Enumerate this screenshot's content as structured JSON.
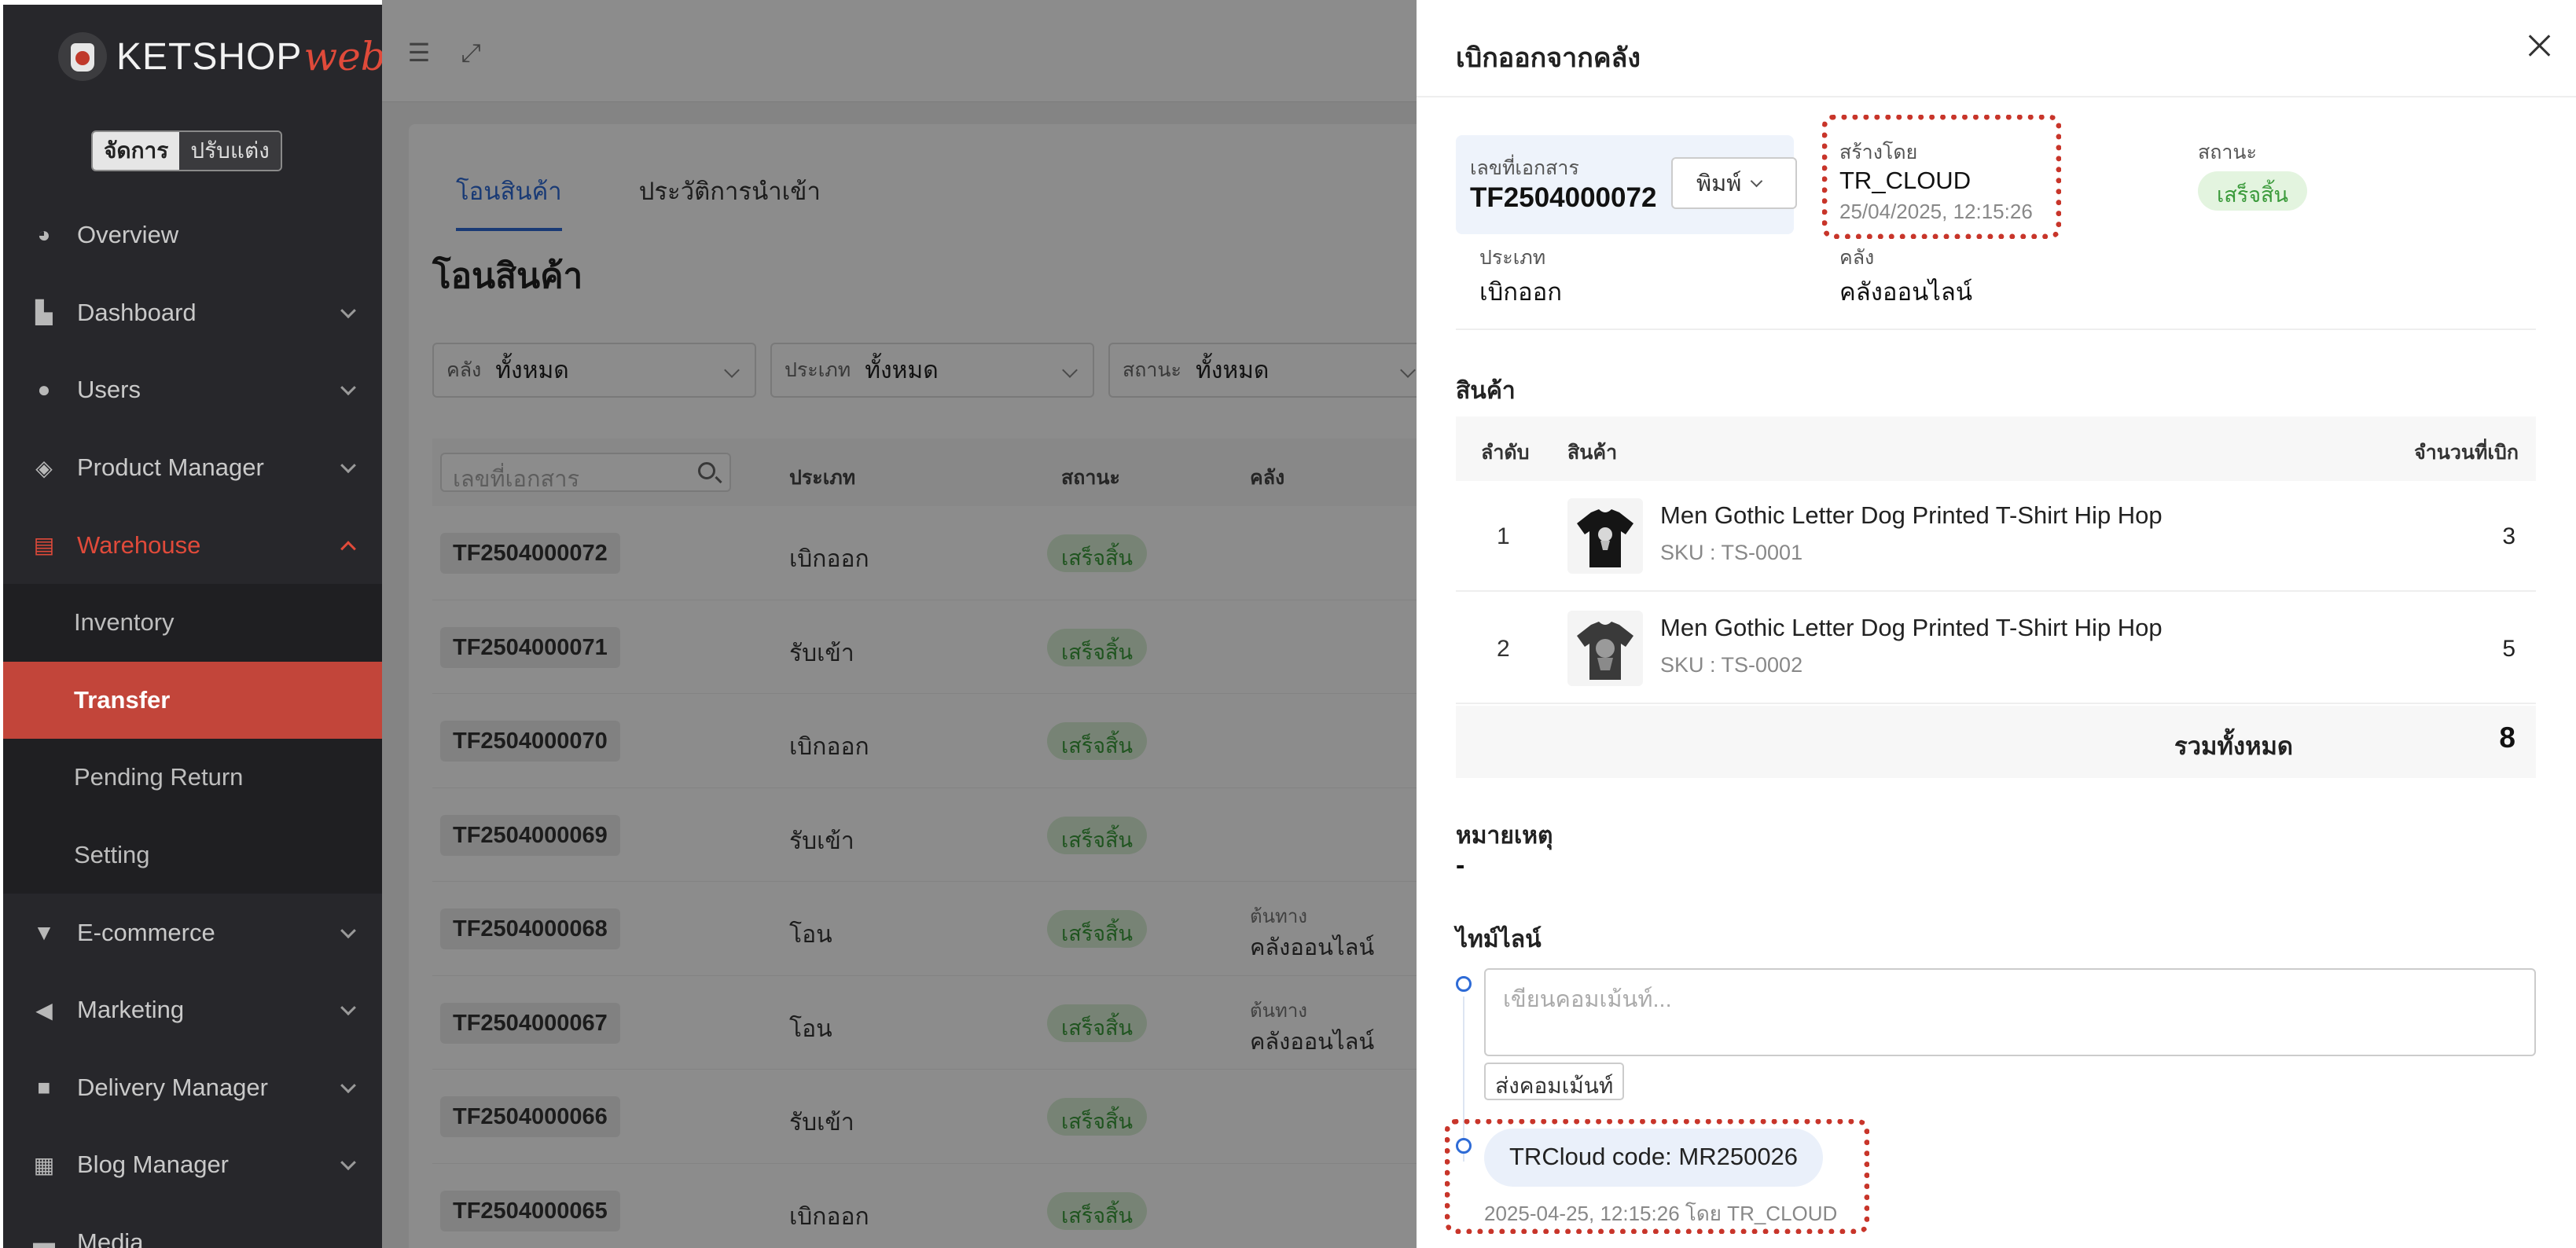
{
  "brand": {
    "name": "KETSHOP",
    "suffix": "web"
  },
  "mode": {
    "manage": "จัดการ",
    "customize": "ปรับแต่ง"
  },
  "nav": [
    {
      "label": "Overview",
      "icon": "pie-chart-icon"
    },
    {
      "label": "Dashboard",
      "icon": "bar-chart-icon"
    },
    {
      "label": "Users",
      "icon": "users-icon"
    },
    {
      "label": "Product Manager",
      "icon": "tags-icon"
    },
    {
      "label": "Warehouse",
      "icon": "warehouse-icon"
    },
    {
      "label": "E-commerce",
      "icon": "cart-icon"
    },
    {
      "label": "Marketing",
      "icon": "megaphone-icon"
    },
    {
      "label": "Delivery Manager",
      "icon": "truck-icon"
    },
    {
      "label": "Blog Manager",
      "icon": "blog-icon"
    },
    {
      "label": "Media",
      "icon": "folder-icon"
    }
  ],
  "warehouse_sub": [
    "Inventory",
    "Transfer",
    "Pending Return",
    "Setting"
  ],
  "main": {
    "tabs": [
      "โอนสินค้า",
      "ประวัติการนำเข้า"
    ],
    "title": "โอนสินค้า",
    "filters": [
      {
        "label": "คลัง",
        "value": "ทั้งหมด"
      },
      {
        "label": "ประเภท",
        "value": "ทั้งหมด"
      },
      {
        "label": "สถานะ",
        "value": "ทั้งหมด"
      }
    ],
    "search_placeholder": "เลขที่เอกสาร",
    "columns": {
      "type": "ประเภท",
      "status": "สถานะ",
      "warehouse": "คลัง"
    },
    "rows": [
      {
        "doc": "TF2504000072",
        "type": "เบิกออก",
        "status": "เสร็จสิ้น",
        "wh_label": "",
        "wh_value": ""
      },
      {
        "doc": "TF2504000071",
        "type": "รับเข้า",
        "status": "เสร็จสิ้น",
        "wh_label": "",
        "wh_value": ""
      },
      {
        "doc": "TF2504000070",
        "type": "เบิกออก",
        "status": "เสร็จสิ้น",
        "wh_label": "",
        "wh_value": ""
      },
      {
        "doc": "TF2504000069",
        "type": "รับเข้า",
        "status": "เสร็จสิ้น",
        "wh_label": "",
        "wh_value": ""
      },
      {
        "doc": "TF2504000068",
        "type": "โอน",
        "status": "เสร็จสิ้น",
        "wh_label": "ต้นทาง",
        "wh_value": "คลังออนไลน์"
      },
      {
        "doc": "TF2504000067",
        "type": "โอน",
        "status": "เสร็จสิ้น",
        "wh_label": "ต้นทาง",
        "wh_value": "คลังออนไลน์"
      },
      {
        "doc": "TF2504000066",
        "type": "รับเข้า",
        "status": "เสร็จสิ้น",
        "wh_label": "",
        "wh_value": ""
      },
      {
        "doc": "TF2504000065",
        "type": "เบิกออก",
        "status": "เสร็จสิ้น",
        "wh_label": "",
        "wh_value": ""
      }
    ]
  },
  "drawer": {
    "title": "เบิกออกจากคลัง",
    "doc_label": "เลขที่เอกสาร",
    "doc_no": "TF2504000072",
    "print_label": "พิมพ์",
    "created_by_label": "สร้างโดย",
    "created_by": "TR_CLOUD",
    "created_at": "25/04/2025, 12:15:26",
    "status_label": "สถานะ",
    "status": "เสร็จสิ้น",
    "type_label": "ประเภท",
    "type": "เบิกออก",
    "warehouse_label": "คลัง",
    "warehouse": "คลังออนไลน์",
    "products_title": "สินค้า",
    "col_index": "ลำดับ",
    "col_product": "สินค้า",
    "col_qty": "จำนวนที่เบิก",
    "products": [
      {
        "index": "1",
        "name": "Men Gothic Letter Dog Printed T-Shirt Hip Hop",
        "sku": "SKU : TS-0001",
        "qty": "3"
      },
      {
        "index": "2",
        "name": "Men Gothic Letter Dog Printed T-Shirt Hip Hop",
        "sku": "SKU : TS-0002",
        "qty": "5"
      }
    ],
    "total_label": "รวมทั้งหมด",
    "total": "8",
    "note_title": "หมายเหตุ",
    "note": "-",
    "timeline_title": "ไทม์ไลน์",
    "comment_placeholder": "เขียนคอมเม้นท์...",
    "send_label": "ส่งคอมเม้นท์",
    "entry_text": "TRCloud code: MR250026",
    "entry_meta": "2025-04-25, 12:15:26 โดย TR_CLOUD"
  },
  "colors": {
    "accent": "#e04a3a",
    "highlight": "#c8352a",
    "link": "#2e6bd6",
    "success": "#3a9a3a"
  }
}
